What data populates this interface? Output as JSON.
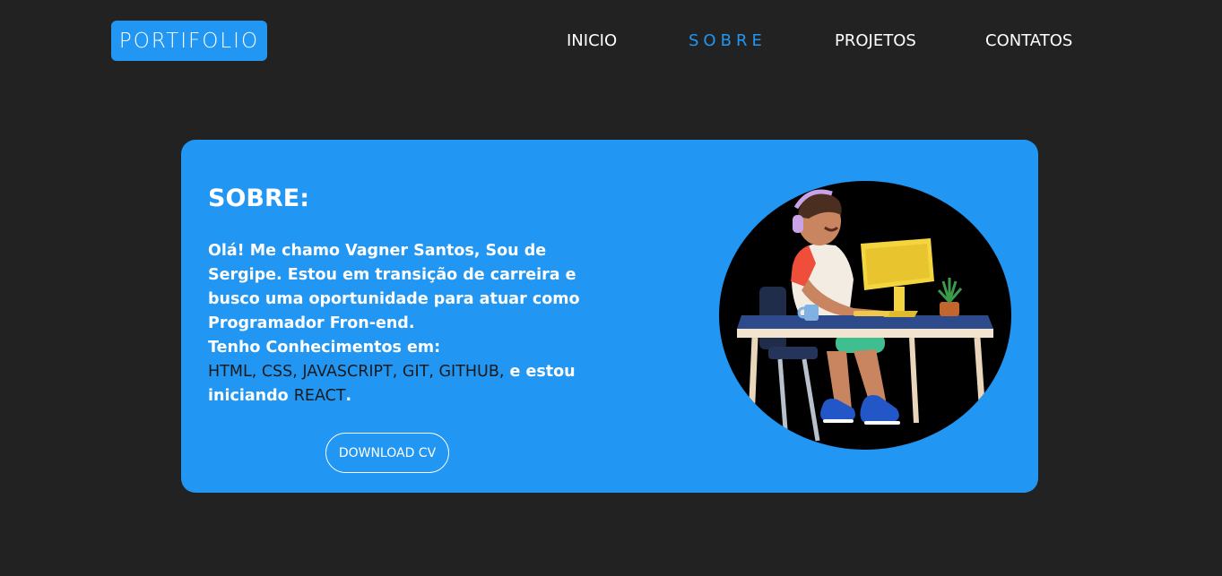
{
  "header": {
    "logo": "PORTIFOLIO",
    "nav": [
      "INICIO",
      "SOBRE",
      "PROJETOS",
      "CONTATOS"
    ]
  },
  "about": {
    "title": "SOBRE:",
    "p1": "Olá! Me chamo Vagner Santos, Sou de Sergipe.",
    "p2": "Estou em transição de carreira e busco uma oportunidade para atuar como Programador Fron-end.",
    "p3": "Tenho Conhecimentos em:",
    "tech1": "HTML, CSS, JAVASCRIPT, GIT, GITHUB,",
    "mid": " e estou iniciando ",
    "tech2": "REACT",
    "end": ".",
    "button": "DOWNLOAD CV"
  },
  "colors": {
    "background": "#222222",
    "accent": "#2196f3",
    "dark_text": "#1a1a1a"
  },
  "icons": {
    "illustration": "developer-at-desk-illustration"
  }
}
